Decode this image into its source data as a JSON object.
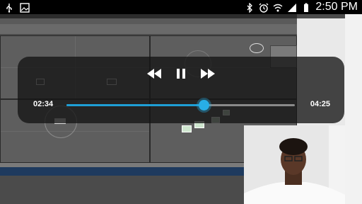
{
  "status_bar": {
    "time": "2:50 PM",
    "left_icons": [
      "usb-icon",
      "image-icon"
    ],
    "right_icons": [
      "bluetooth-icon",
      "alarm-icon",
      "wifi-icon",
      "signal-icon",
      "battery-icon"
    ]
  },
  "player": {
    "elapsed": "02:34",
    "total": "04:25",
    "progress": 0.6,
    "controls": [
      "rewind-button",
      "pause-button",
      "fast-forward-button"
    ],
    "accent_color": "#1e9fd6"
  }
}
